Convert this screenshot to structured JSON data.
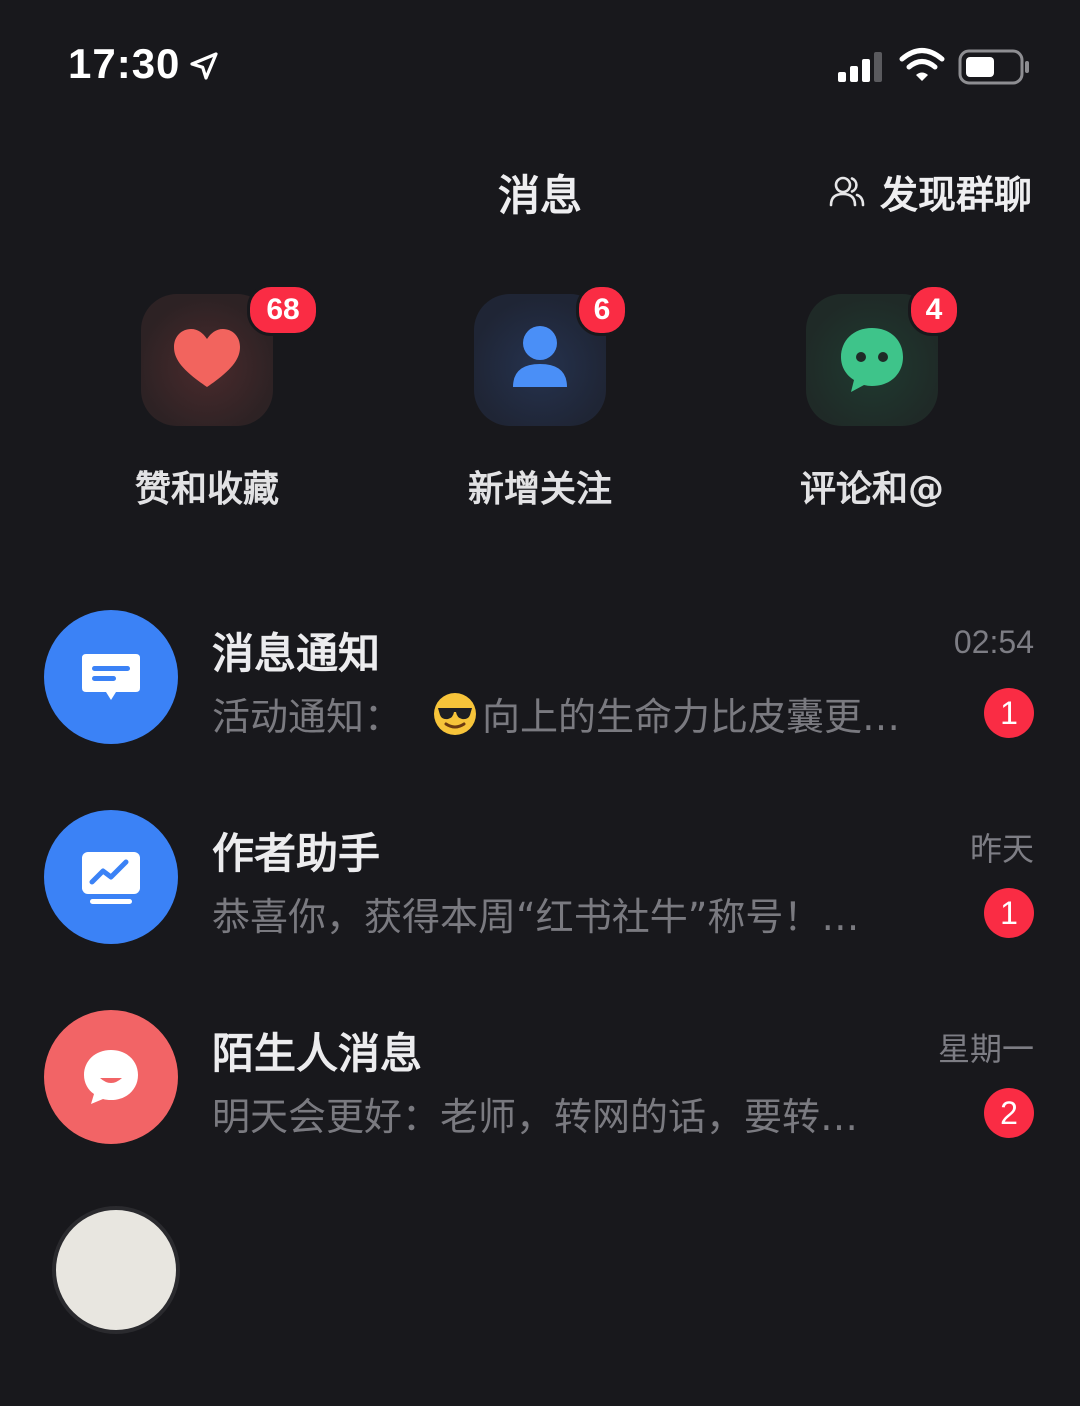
{
  "status_bar": {
    "time": "17:30",
    "icons": [
      "location-arrow-icon",
      "cellular-signal-icon",
      "wifi-icon",
      "battery-icon"
    ]
  },
  "header": {
    "title": "消息",
    "discover_label": "发现群聊",
    "discover_icon": "group-people-icon"
  },
  "shortcuts": [
    {
      "label": "赞和收藏",
      "badge": "68",
      "icon": "heart-icon",
      "color": "#f2645e"
    },
    {
      "label": "新增关注",
      "badge": "6",
      "icon": "person-icon",
      "color": "#4a8ff7"
    },
    {
      "label": "评论和@",
      "badge": "4",
      "icon": "chat-bubble-icon",
      "color": "#3ec48a"
    }
  ],
  "messages": [
    {
      "title": "消息通知",
      "time": "02:54",
      "preview_prefix": "活动通知：",
      "preview_emoji": "sunglasses-emoji",
      "preview": "向上的生命力比皮囊更…",
      "unread": "1",
      "avatar_icon": "notification-message-icon",
      "avatar_color": "#3b82f6"
    },
    {
      "title": "作者助手",
      "time": "昨天",
      "preview": "恭喜你，获得本周“红书社牛”称号！…",
      "unread": "1",
      "avatar_icon": "trend-chart-icon",
      "avatar_color": "#3b82f6"
    },
    {
      "title": "陌生人消息",
      "time": "星期一",
      "preview": "明天会更好：老师，转网的话，要转…",
      "unread": "2",
      "avatar_icon": "chat-bubble-icon",
      "avatar_color": "#f26466"
    }
  ],
  "colors": {
    "background": "#18181c",
    "badge": "#fa2c44",
    "secondary_text": "#7a7a80"
  }
}
